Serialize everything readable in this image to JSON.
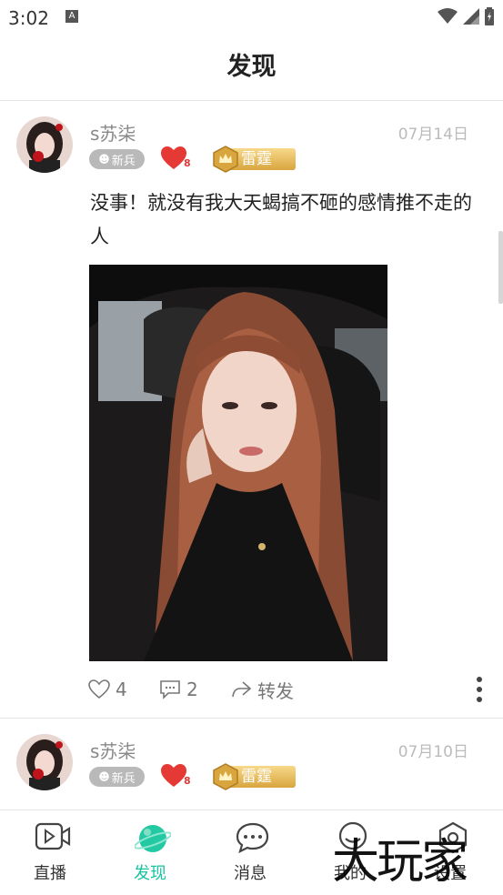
{
  "status_bar": {
    "time": "3:02",
    "notification_icon": "A"
  },
  "header": {
    "title": "发现"
  },
  "posts": [
    {
      "username": "s苏柒",
      "date": "07月14日",
      "rookie_badge": "新兵",
      "heart_count": "8",
      "rank_title": "雷霆",
      "text": "没事！就没有我大天蝎搞不砸的感情推不走的人",
      "likes": "4",
      "comments": "2",
      "share_label": "转发"
    },
    {
      "username": "s苏柒",
      "date": "07月10日",
      "rookie_badge": "新兵",
      "heart_count": "8",
      "rank_title": "雷霆"
    }
  ],
  "nav": {
    "items": [
      {
        "label": "直播",
        "icon": "video-icon"
      },
      {
        "label": "发现",
        "icon": "planet-icon",
        "active": true
      },
      {
        "label": "消息",
        "icon": "chat-icon"
      },
      {
        "label": "我的",
        "icon": "user-icon"
      },
      {
        "label": "设置",
        "icon": "settings-icon"
      }
    ]
  },
  "watermark": "大玩家",
  "colors": {
    "accent": "#17c3a0",
    "heart": "#e53935",
    "rank_gold": "#e0b050"
  }
}
